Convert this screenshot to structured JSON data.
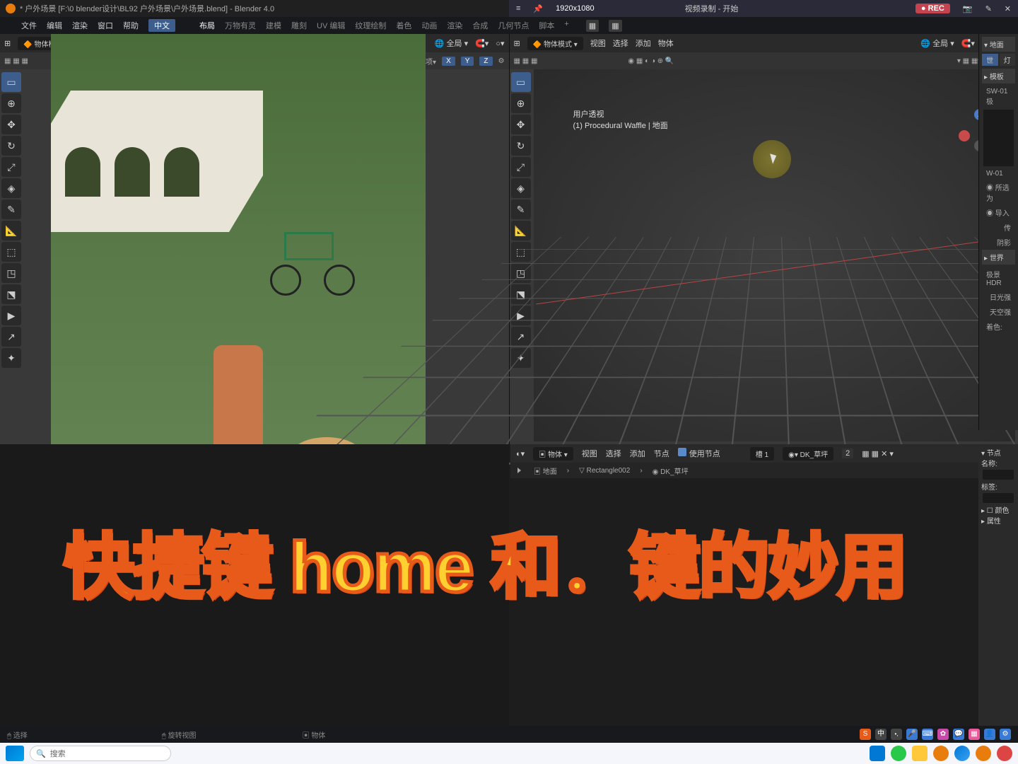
{
  "title": "* 户外场景 [F:\\0 blender设计\\BL92 户外场景\\户外场景.blend] - Blender 4.0",
  "topstrip": {
    "res": "1920x1080",
    "recstatus": "视频录制 - 开始",
    "rec": "REC"
  },
  "menu": {
    "file": "文件",
    "edit": "编辑",
    "render": "渲染",
    "window": "窗口",
    "help": "帮助",
    "lang": "中文"
  },
  "tabs": [
    "布局",
    "万物有灵",
    "建模",
    "雕刻",
    "UV 编辑",
    "纹理绘制",
    "着色",
    "动画",
    "渲染",
    "合成",
    "几何节点",
    "脚本"
  ],
  "mode": "物体模式",
  "vpmenu": {
    "view": "视图",
    "select": "选择",
    "add": "添加",
    "object": "物体",
    "global": "全局"
  },
  "vp2": {
    "info1": "用户透视",
    "info2": "(1) Procedural Waffle | 地面"
  },
  "opts": "选项",
  "rpanel": {
    "title": "地面",
    "t1": "世",
    "t2": "灯",
    "sec1": "模板",
    "i1": "SW-01极",
    "i2": "W-01",
    "all": "所选为",
    "imp": "导入",
    "pass": "传",
    "shad": "阴影",
    "world": "世界",
    "hdr": "极景HDR",
    "sun": "日光强",
    "sky": "天空强",
    "col": "着色:"
  },
  "node": {
    "obj": "物体",
    "view": "视图",
    "select": "选择",
    "add": "添加",
    "node": "节点",
    "use": "使用节点",
    "slot": "槽 1",
    "mat": "DK_草坪",
    "slotnum": "2",
    "bc1": "地面",
    "bc2": "Rectangle002",
    "bc3": "DK_草坪",
    "sec": "节点",
    "name": "名称:",
    "tag": "标签:",
    "color": "颜色",
    "attr": "属性"
  },
  "status": {
    "sel": "选择",
    "rot": "旋转视图",
    "obj": "物体",
    "ime": "中"
  },
  "taskbar": {
    "search": "搜索"
  },
  "overlay": "快捷键 home 和．键的妙用",
  "axes": {
    "x": "X",
    "y": "Y",
    "z": "Z"
  }
}
